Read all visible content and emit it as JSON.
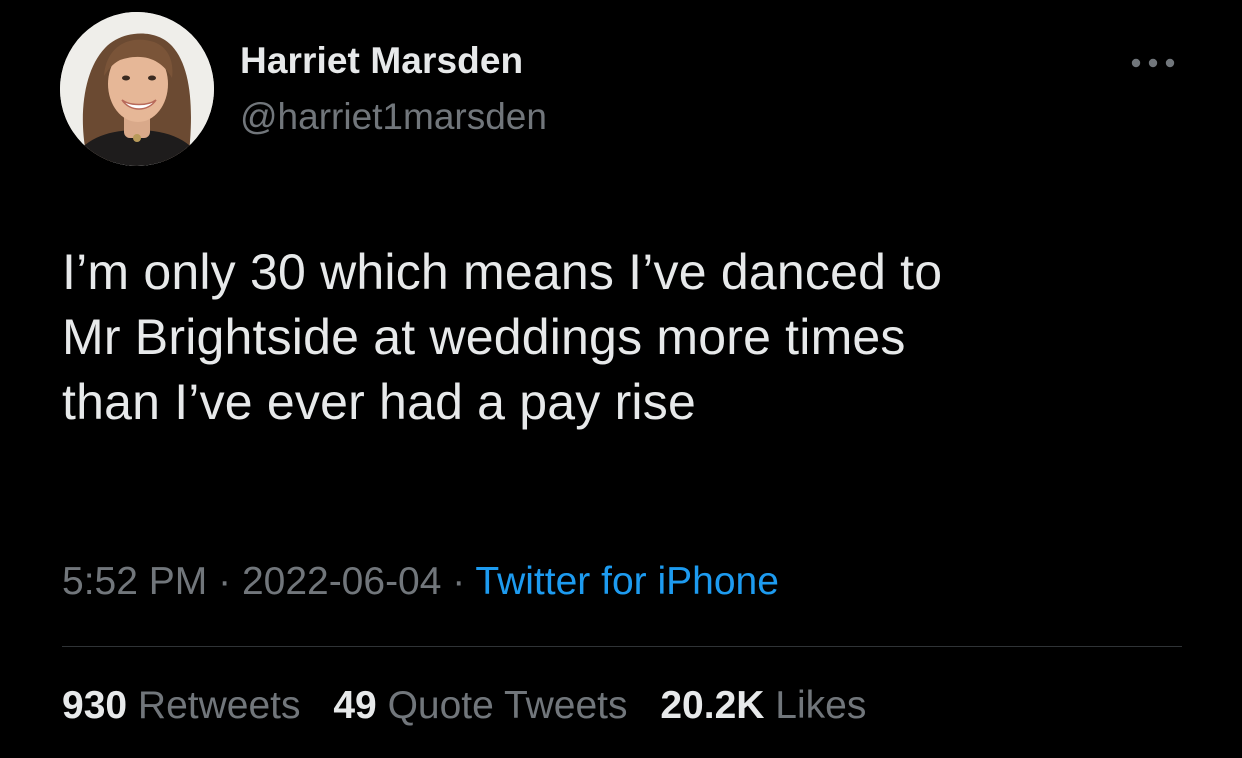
{
  "colors": {
    "background": "#000000",
    "primary_text": "#e7e9ea",
    "secondary_text": "#71767b",
    "link": "#1d9bf0",
    "divider": "#2f3336"
  },
  "author": {
    "avatar_icon": "profile-photo",
    "name": "Harriet Marsden",
    "handle": "@harriet1marsden"
  },
  "more_icon": "more-horizontal-icon",
  "tweet": {
    "lines": [
      "I’m only 30 which means I’ve danced to",
      "Mr Brightside at weddings more times",
      "than I’ve ever had a pay rise"
    ]
  },
  "meta": {
    "time": "5:52 PM",
    "separator": "·",
    "date": "2022-06-04",
    "source": "Twitter for iPhone"
  },
  "stats": {
    "retweets": {
      "count": "930",
      "label": "Retweets"
    },
    "quotes": {
      "count": "49",
      "label": "Quote Tweets"
    },
    "likes": {
      "count": "20.2K",
      "label": "Likes"
    }
  }
}
